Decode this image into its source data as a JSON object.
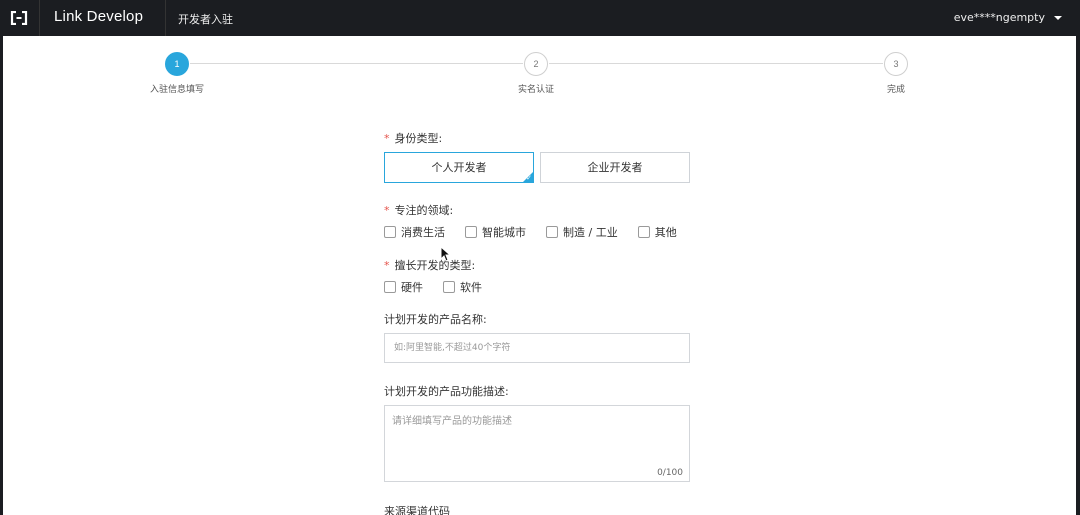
{
  "header": {
    "brand": "Link Develop",
    "nav_item": "开发者入驻",
    "user": "eve****ngempty",
    "logo_icon": "link-develop-logo-icon",
    "dropdown_icon": "caret-down-icon"
  },
  "steps": [
    {
      "number": "1",
      "label": "入驻信息填写",
      "active": true
    },
    {
      "number": "2",
      "label": "实名认证",
      "active": false
    },
    {
      "number": "3",
      "label": "完成",
      "active": false
    }
  ],
  "form": {
    "identity": {
      "label": "身份类型:",
      "options": [
        "个人开发者",
        "企业开发者"
      ],
      "selected": "个人开发者"
    },
    "domain": {
      "label": "专注的领域:",
      "options": [
        "消费生活",
        "智能城市",
        "制造 / 工业",
        "其他"
      ]
    },
    "dev_type": {
      "label": "擅长开发的类型:",
      "options": [
        "硬件",
        "软件"
      ]
    },
    "product_name": {
      "label": "计划开发的产品名称:",
      "placeholder": "如:阿里智能,不超过40个字符"
    },
    "product_desc": {
      "label": "计划开发的产品功能描述:",
      "placeholder": "请详细填写产品的功能描述",
      "counter": "0/100"
    },
    "source_code": {
      "label": "来源渠道代码"
    }
  },
  "colors": {
    "accent": "#29a6dc",
    "required": "#e5534b",
    "topbar": "#1b1d21"
  }
}
